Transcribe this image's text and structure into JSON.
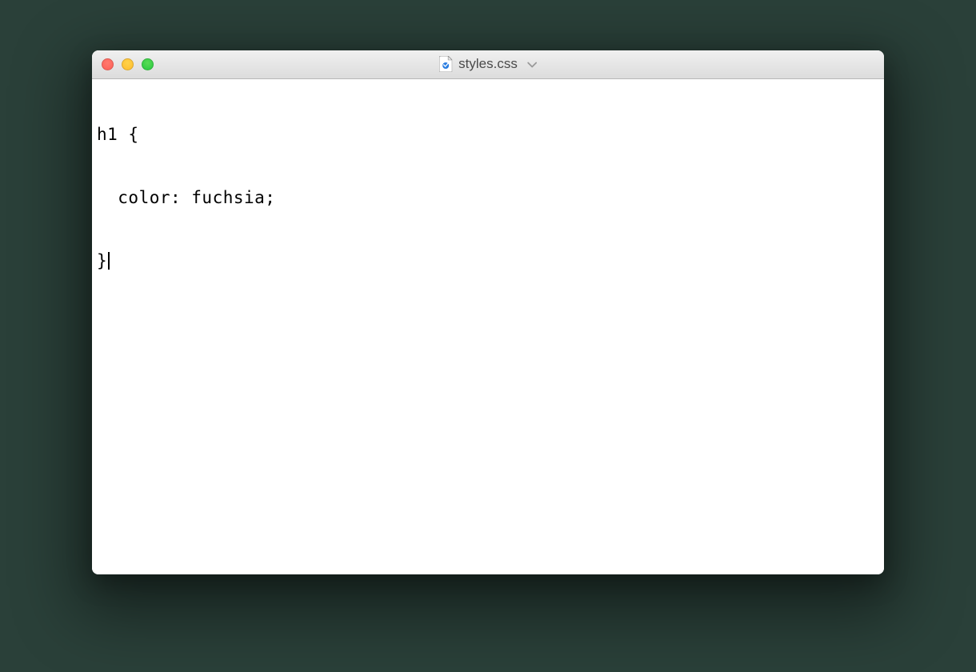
{
  "window": {
    "title": "styles.css",
    "file_icon": "css-file-icon"
  },
  "traffic_lights": {
    "close": "close",
    "minimize": "minimize",
    "zoom": "zoom"
  },
  "editor": {
    "lines": [
      "h1 {",
      "  color: fuchsia;",
      "}"
    ],
    "line1": "h1 {",
    "line2": "  color: fuchsia;",
    "line3": "}"
  }
}
